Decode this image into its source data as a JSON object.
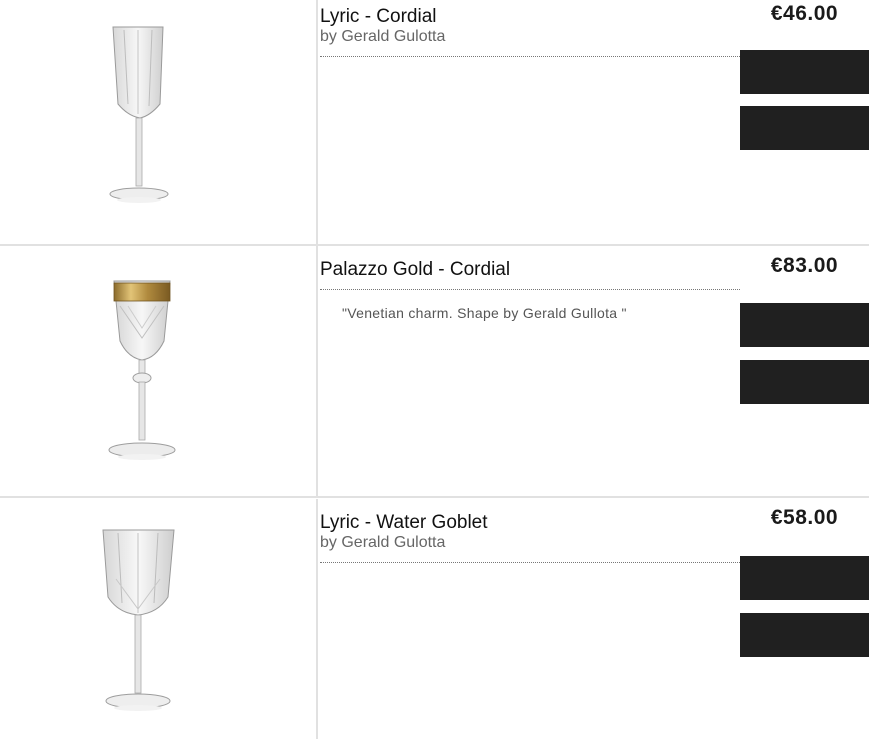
{
  "products": [
    {
      "title": "Lyric - Cordial",
      "subtitle": "by Gerald Gulotta",
      "description": "",
      "price": "€46.00",
      "image_icon": "cordial-glass-image",
      "buttons": [
        "",
        ""
      ]
    },
    {
      "title": "Palazzo Gold - Cordial",
      "subtitle": "",
      "description": "\"Venetian charm. Shape by Gerald Gullota \"",
      "price": "€83.00",
      "image_icon": "gold-rim-cordial-glass-image",
      "buttons": [
        "",
        ""
      ]
    },
    {
      "title": "Lyric - Water Goblet",
      "subtitle": "by Gerald Gulotta",
      "description": "",
      "price": "€58.00",
      "image_icon": "water-goblet-image",
      "buttons": [
        "",
        ""
      ]
    }
  ],
  "colors": {
    "button_bg": "#202020",
    "divider": "#e1e1e1",
    "subtitle": "#666666"
  }
}
